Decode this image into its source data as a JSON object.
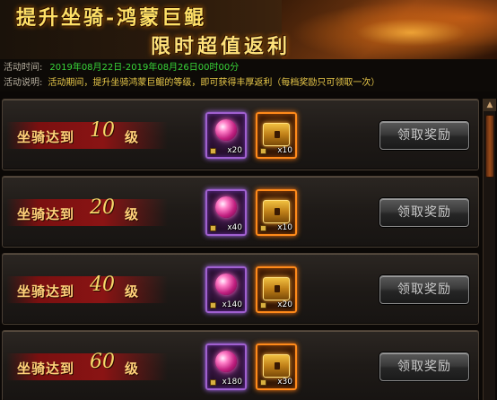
{
  "banner": {
    "title": "提升坐骑-鸿蒙巨鲲",
    "subtitle": "限时超值返利"
  },
  "info": {
    "time_label": "活动时间:",
    "time_value": "2019年08月22日-2019年08月26日00时00分",
    "desc_label": "活动说明:",
    "desc_value": "活动期间，提升坐骑鸿蒙巨鲲的等级，即可获得丰厚返利（每档奖励只可领取一次）"
  },
  "rewards": [
    {
      "prefix": "坐骑达到",
      "level": "10",
      "suffix": "级",
      "item1_qty": "x20",
      "item2_qty": "x10",
      "button": "领取奖励"
    },
    {
      "prefix": "坐骑达到",
      "level": "20",
      "suffix": "级",
      "item1_qty": "x40",
      "item2_qty": "x10",
      "button": "领取奖励"
    },
    {
      "prefix": "坐骑达到",
      "level": "40",
      "suffix": "级",
      "item1_qty": "x140",
      "item2_qty": "x20",
      "button": "领取奖励"
    },
    {
      "prefix": "坐骑达到",
      "level": "60",
      "suffix": "级",
      "item1_qty": "x180",
      "item2_qty": "x30",
      "button": "领取奖励"
    }
  ],
  "icons": {
    "item1": "pink-orb-icon",
    "item2": "golden-chest-icon",
    "lock": "lock-icon",
    "scroll_up": "arrow-up-icon"
  },
  "colors": {
    "banner_text": "#ffe066",
    "time_text": "#39d639",
    "desc_text": "#e8c84a",
    "level_text": "#ffd27a",
    "purple_frame": "#a060d0",
    "orange_frame": "#ff8a1a"
  }
}
